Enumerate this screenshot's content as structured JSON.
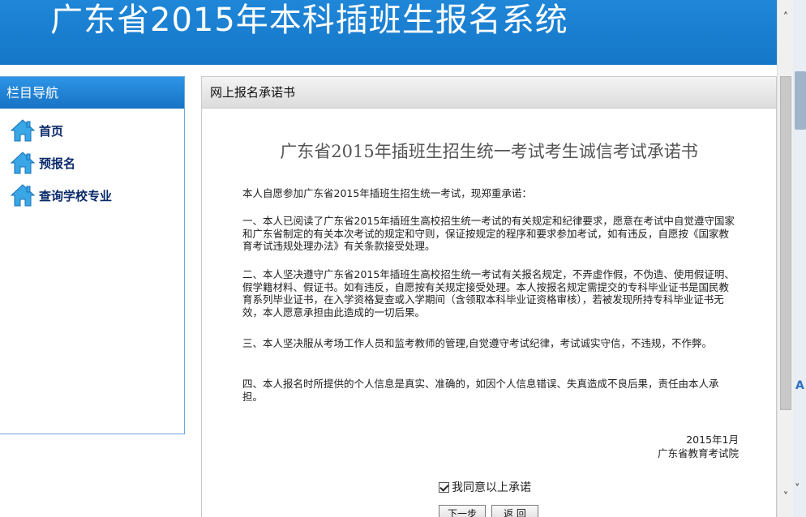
{
  "header": {
    "title": "广东省2015年本科插班生报名系统"
  },
  "sidebar": {
    "title": "栏目导航",
    "items": [
      {
        "label": "首页",
        "icon": "home-icon"
      },
      {
        "label": "预报名",
        "icon": "home-icon"
      },
      {
        "label": "查询学校专业",
        "icon": "home-icon"
      }
    ]
  },
  "main": {
    "header": "网上报名承诺书",
    "doc_title": "广东省2015年插班生招生统一考试考生诚信考试承诺书",
    "paragraphs": [
      "本人自愿参加广东省2015年插班生招生统一考试，现郑重承诺：",
      "一、本人已阅读了广东省2015年插班生高校招生统一考试的有关规定和纪律要求，愿意在考试中自觉遵守国家和广东省制定的有关本次考试的规定和守则，保证按规定的程序和要求参加考试，如有违反，自愿按《国家教育考试违规处理办法》有关条款接受处理。",
      "二、本人坚决遵守广东省2015年插班生高校招生统一考试有关报名规定，不弄虚作假，不伪造、使用假证明、假学籍材料、假证书。如有违反，自愿按有关规定接受处理。本人按报名规定需提交的专科毕业证书是国民教育系列毕业证书，在入学资格复查或入学期间（含领取本科毕业证资格审核），若被发现所持专科毕业证书无效，本人愿意承担由此造成的一切后果。",
      "三、本人坚决服从考场工作人员和监考教师的管理,自觉遵守考试纪律，考试诚实守信，不违规，不作弊。",
      "四、本人报名时所提供的个人信息是真实、准确的，如因个人信息错误、失真造成不良后果，责任由本人承担。"
    ],
    "date": "2015年1月",
    "issuer": "广东省教育考试院",
    "agree_label": "我同意以上承诺",
    "agree_checked": true,
    "next_button": "下一步",
    "back_button": "返 回"
  },
  "scrollbar": {
    "up_icon": "chevron-up-icon",
    "down_icon": "chevron-down-icon"
  },
  "colors": {
    "banner": "#1a7fd0",
    "nav_text": "#0a2a6a",
    "sidebar_head": "#1f84d6"
  }
}
